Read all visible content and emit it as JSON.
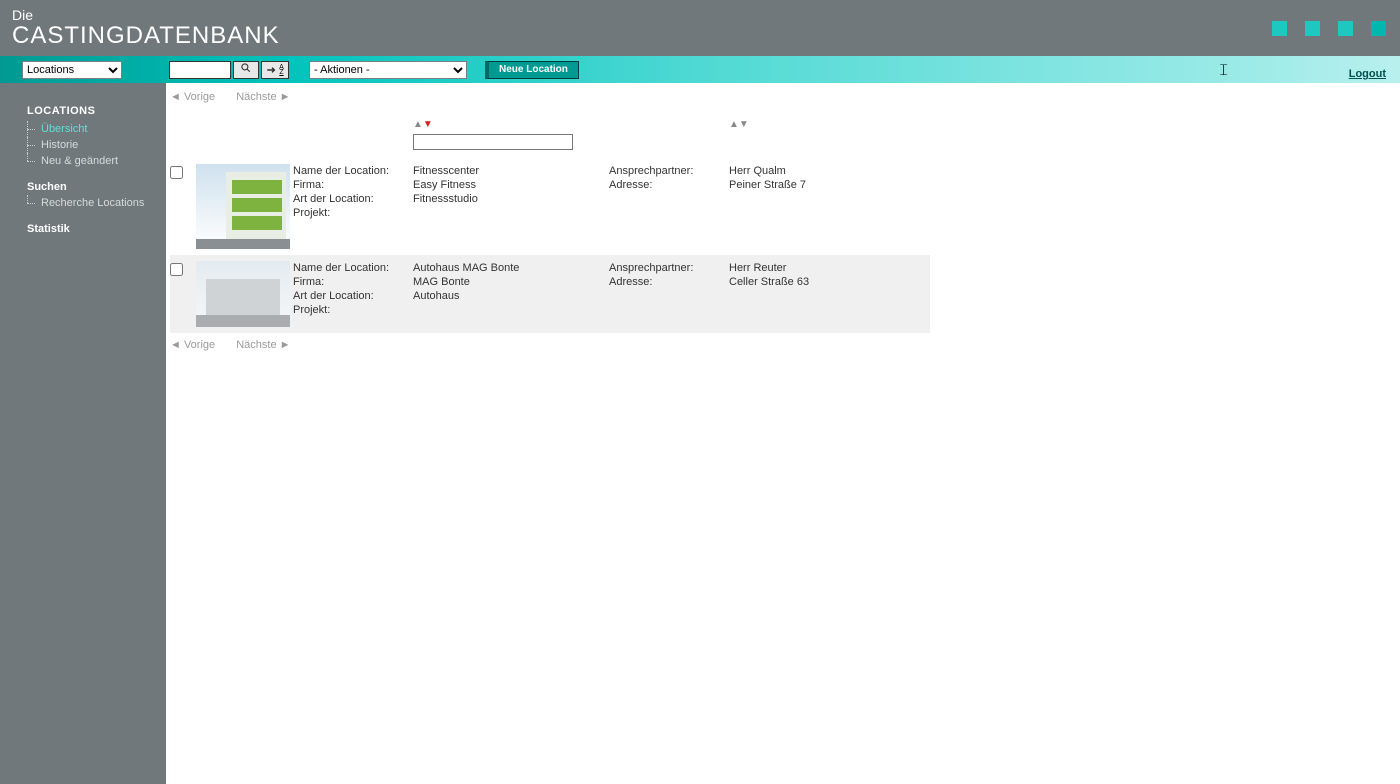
{
  "header": {
    "title_line1": "Die",
    "title_line2": "CASTINGDATENBANK"
  },
  "toolbar": {
    "section_select": "Locations",
    "search_value": "",
    "actions_select": "- Aktionen -",
    "new_location_label": "Neue Location",
    "logout_label": "Logout"
  },
  "sidebar": {
    "heading": "LOCATIONS",
    "items": [
      {
        "label": "Übersicht",
        "active": true
      },
      {
        "label": "Historie",
        "active": false
      },
      {
        "label": "Neu & geändert",
        "active": false
      }
    ],
    "search_heading": "Suchen",
    "search_items": [
      {
        "label": "Recherche Locations"
      }
    ],
    "stats_heading": "Statistik"
  },
  "pager": {
    "prev": "◄ Vorige",
    "next": "Nächste ►"
  },
  "sorter": {
    "up": "▲",
    "down": "▼"
  },
  "field_labels": {
    "name": "Name der Location:",
    "firma": "Firma:",
    "art": "Art der Location:",
    "projekt": "Projekt:",
    "ansprech": "Ansprechpartner:",
    "adresse": "Adresse:"
  },
  "rows": [
    {
      "name": "Fitnesscenter",
      "firma": "Easy Fitness",
      "art": "Fitnessstudio",
      "projekt": "",
      "ansprech": "Herr Qualm",
      "adresse": "Peiner Straße 7"
    },
    {
      "name": "Autohaus MAG Bonte",
      "firma": "MAG Bonte",
      "art": "Autohaus",
      "projekt": "",
      "ansprech": "Herr Reuter",
      "adresse": "Celler Straße 63"
    }
  ]
}
